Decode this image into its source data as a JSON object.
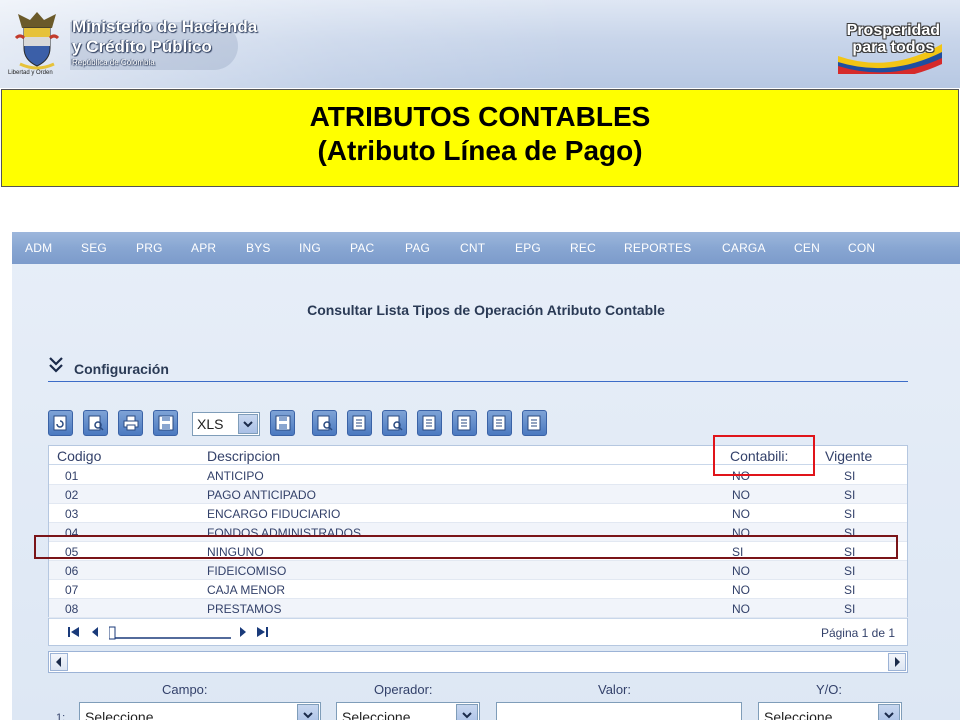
{
  "header": {
    "crest_caption": "Libertad y Orden",
    "ministry_line1": "Ministerio de Hacienda",
    "ministry_line2": "y Crédito Público",
    "ministry_line3": "República de Colombia",
    "slogan_line1": "Prosperidad",
    "slogan_line2": "para todos"
  },
  "slide_title": {
    "line1": "ATRIBUTOS CONTABLES",
    "line2": "(Atributo Línea de Pago)"
  },
  "menu": [
    "ADM",
    "SEG",
    "PRG",
    "APR",
    "BYS",
    "ING",
    "PAC",
    "PAG",
    "CNT",
    "EPG",
    "REC",
    "REPORTES",
    "CARGA",
    "CEN",
    "CON"
  ],
  "screen_title": "Consultar Lista Tipos de Operación Atributo Contable",
  "section_label": "Configuración",
  "toolbar": {
    "export_format": "XLS"
  },
  "table": {
    "columns": [
      "Codigo",
      "Descripcion",
      "Contabili:",
      "Vigente"
    ],
    "rows": [
      [
        "01",
        "ANTICIPO",
        "NO",
        "SI"
      ],
      [
        "02",
        "PAGO ANTICIPADO",
        "NO",
        "SI"
      ],
      [
        "03",
        "ENCARGO FIDUCIARIO",
        "NO",
        "SI"
      ],
      [
        "04",
        "FONDOS ADMINISTRADOS",
        "NO",
        "SI"
      ],
      [
        "05",
        "NINGUNO",
        "SI",
        "SI"
      ],
      [
        "06",
        "FIDEICOMISO",
        "NO",
        "SI"
      ],
      [
        "07",
        "CAJA MENOR",
        "NO",
        "SI"
      ],
      [
        "08",
        "PRESTAMOS",
        "NO",
        "SI"
      ]
    ]
  },
  "pager": {
    "page_text": "Página 1 de 1"
  },
  "filter": {
    "campo_label": "Campo:",
    "operador_label": "Operador:",
    "valor_label": "Valor:",
    "yo_label": "Y/O:",
    "row_number": "1:",
    "campo_value": "Seleccione",
    "operador_value": "Seleccione",
    "valor_value": "",
    "yo_value": "Seleccione"
  },
  "colors": {
    "title_background": "#ffff00",
    "menubar": "#88a6d2",
    "highlight_red": "#e0141a",
    "highlight_dark": "#7a1418"
  }
}
